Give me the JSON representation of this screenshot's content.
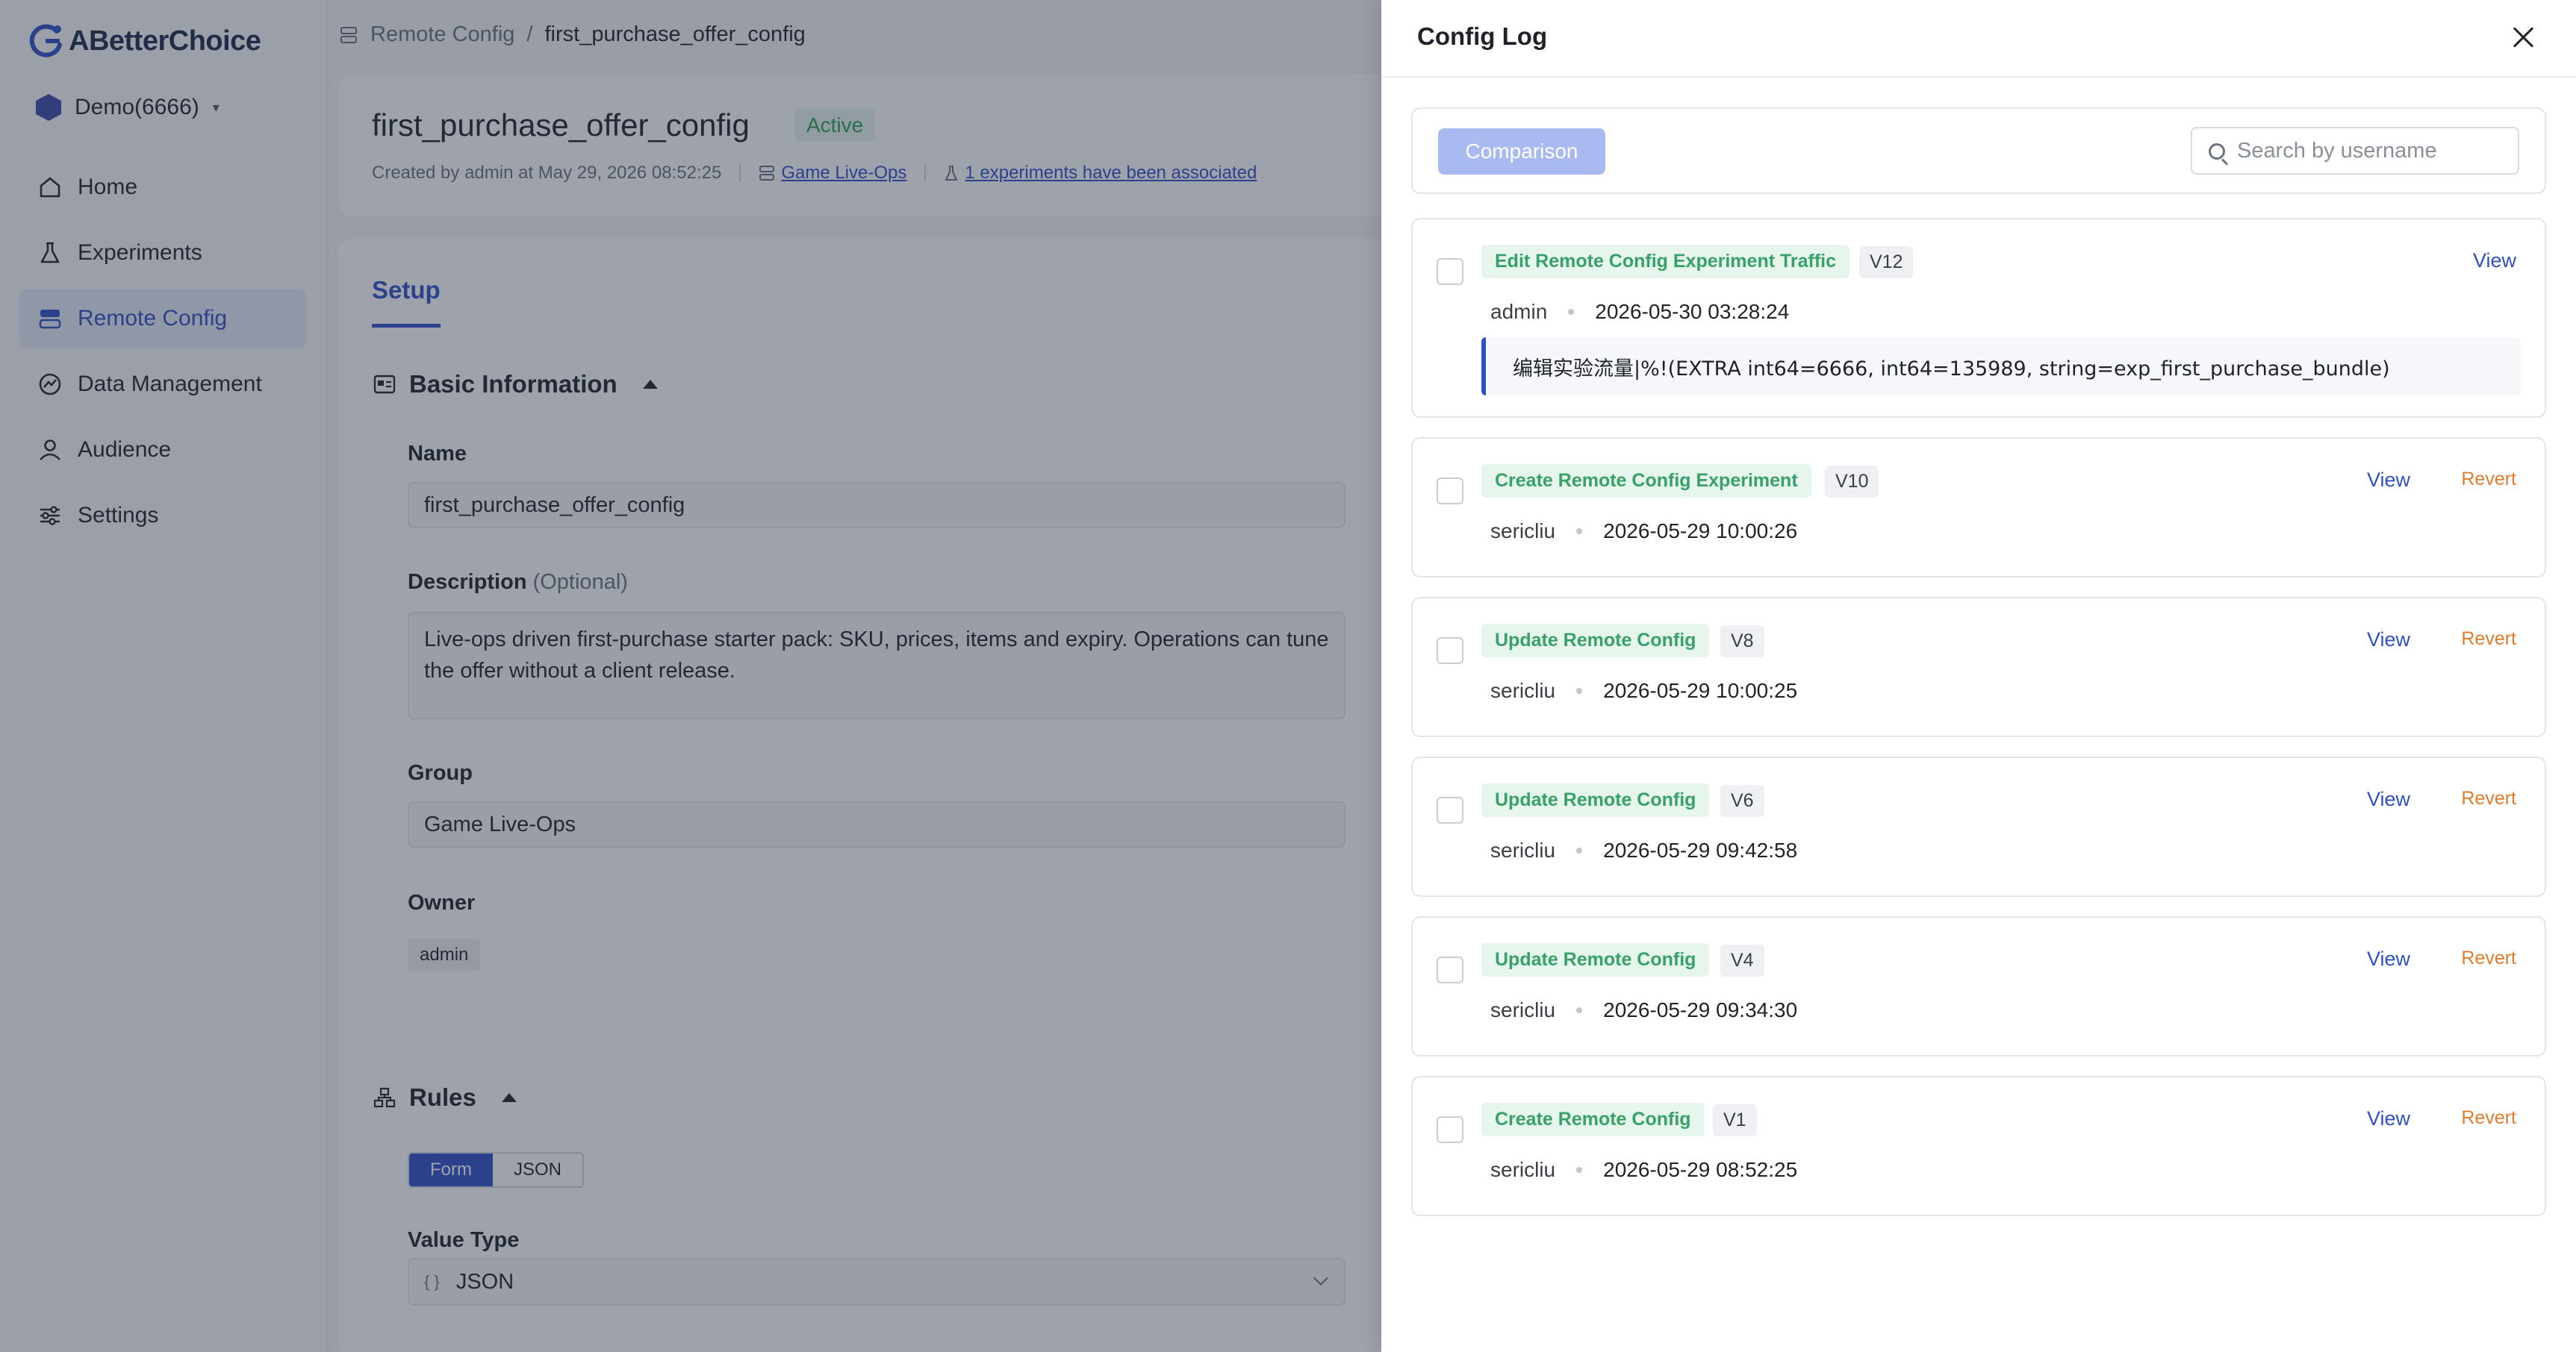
{
  "app": {
    "name": "ABetterChoice",
    "workspace": "Demo(6666)"
  },
  "colors": {
    "accent": "#2f4fc7",
    "success": "#38a169",
    "warning": "#e07b2e"
  },
  "sidebar": {
    "items": [
      {
        "label": "Home",
        "icon": "home-icon"
      },
      {
        "label": "Experiments",
        "icon": "flask-icon"
      },
      {
        "label": "Remote Config",
        "icon": "server-icon",
        "active": true
      },
      {
        "label": "Data Management",
        "icon": "chart-icon"
      },
      {
        "label": "Audience",
        "icon": "user-icon"
      },
      {
        "label": "Settings",
        "icon": "sliders-icon"
      }
    ]
  },
  "breadcrumb": {
    "parent": "Remote Config",
    "separator": "/",
    "current": "first_purchase_offer_config"
  },
  "header": {
    "title": "first_purchase_offer_config",
    "status": "Active",
    "created": "Created by admin at May 29, 2026 08:52:25",
    "group_link": "Game Live-Ops",
    "experiments_link": "1 experiments have been associated"
  },
  "setup": {
    "tab": "Setup",
    "basic_info": "Basic Information",
    "name_label": "Name",
    "name_value": "first_purchase_offer_config",
    "description_label": "Description",
    "description_optional": "(Optional)",
    "description_value": "Live-ops driven first-purchase starter pack: SKU, prices, items and expiry. Operations can tune the offer without a client release.",
    "group_label": "Group",
    "group_value": "Game Live-Ops",
    "owner_label": "Owner",
    "owner_value": "admin",
    "rules": "Rules",
    "mode_form": "Form",
    "mode_json": "JSON",
    "value_type_label": "Value Type",
    "value_type_value": "JSON",
    "value_type_icon": "{ }"
  },
  "drawer": {
    "title": "Config Log",
    "compare_label": "Comparison",
    "search_placeholder": "Search by username",
    "view_label": "View",
    "revert_label": "Revert",
    "logs": [
      {
        "op": "Edit Remote Config Experiment Traffic",
        "version": "V12",
        "user": "admin",
        "time": "2026-05-30 03:28:24",
        "detail": "编辑实验流量|%!(EXTRA int64=6666, int64=135989, string=exp_first_purchase_bundle)"
      },
      {
        "op": "Create Remote Config Experiment",
        "version": "V10",
        "user": "sericliu",
        "time": "2026-05-29 10:00:26"
      },
      {
        "op": "Update Remote Config",
        "version": "V8",
        "user": "sericliu",
        "time": "2026-05-29 10:00:25"
      },
      {
        "op": "Update Remote Config",
        "version": "V6",
        "user": "sericliu",
        "time": "2026-05-29 09:42:58"
      },
      {
        "op": "Update Remote Config",
        "version": "V4",
        "user": "sericliu",
        "time": "2026-05-29 09:34:30"
      },
      {
        "op": "Create Remote Config",
        "version": "V1",
        "user": "sericliu",
        "time": "2026-05-29 08:52:25"
      }
    ]
  }
}
